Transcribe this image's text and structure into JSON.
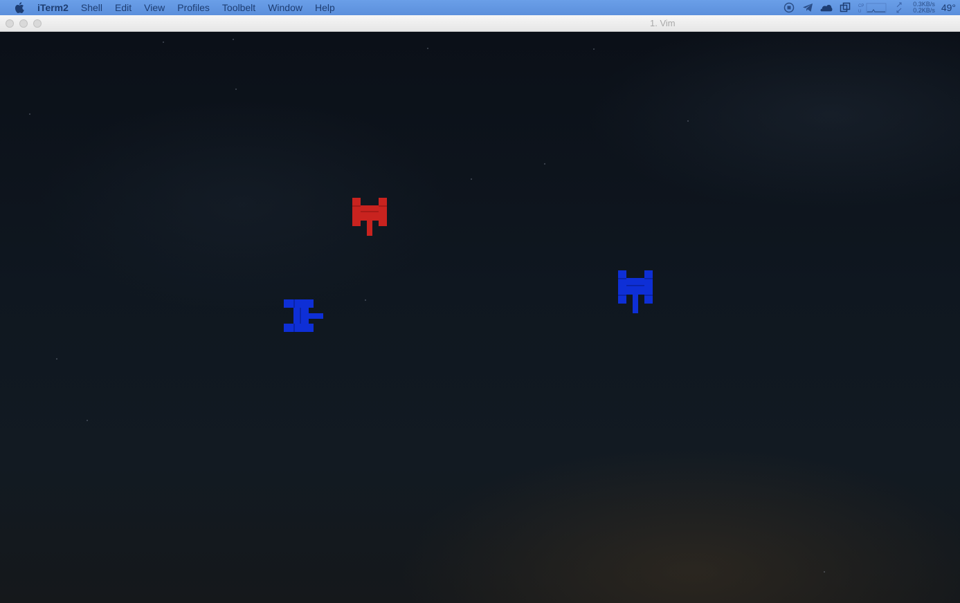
{
  "menubar": {
    "apple_icon": "apple-logo-icon",
    "app_name": "iTerm2",
    "items": [
      "Shell",
      "Edit",
      "View",
      "Profiles",
      "Toolbelt",
      "Window",
      "Help"
    ],
    "status": {
      "icons": [
        "record-icon",
        "telegram-icon",
        "cloud-icon",
        "window-stack-icon",
        "monitor-graph-icon",
        "expand-arrows-icon"
      ],
      "net_up": "0.3KB/s",
      "net_down": "0.2KB/s",
      "temperature": "49°"
    }
  },
  "window": {
    "title": "1. Vim",
    "buttons": [
      "close",
      "minimize",
      "zoom"
    ]
  },
  "game": {
    "colors": {
      "player": "#c9231f",
      "enemy": "#0e2fd6",
      "background": "#0c121a"
    },
    "tanks": [
      {
        "name": "player-tank",
        "team": "player",
        "facing": "down"
      },
      {
        "name": "enemy-tank-1",
        "team": "enemy",
        "facing": "right"
      },
      {
        "name": "enemy-tank-2",
        "team": "enemy",
        "facing": "down"
      }
    ]
  }
}
